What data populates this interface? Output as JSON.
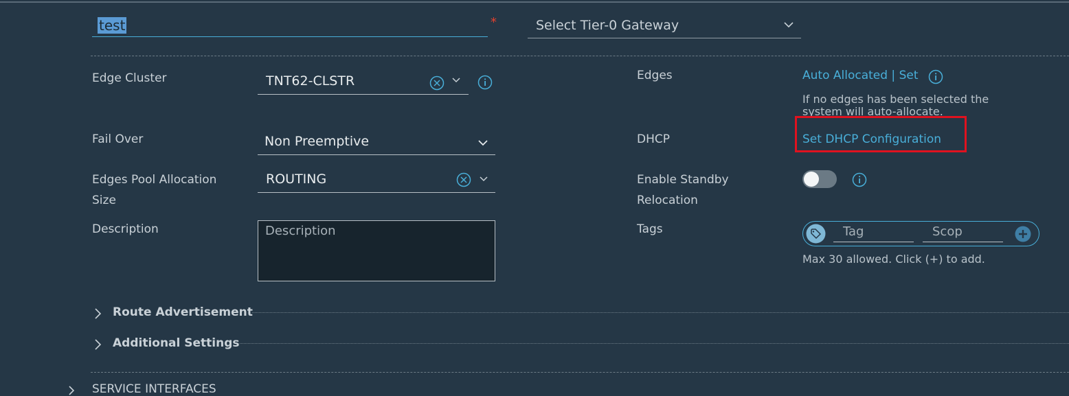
{
  "name_field": {
    "value": "test",
    "required_mark": "*"
  },
  "tier0": {
    "placeholder": "Select Tier-0 Gateway"
  },
  "edge_cluster": {
    "label": "Edge Cluster",
    "value": "TNT62-CLSTR"
  },
  "edges": {
    "label": "Edges",
    "link": "Auto Allocated | Set",
    "help_line1": "If no edges has been selected the",
    "help_line2": "system will auto-allocate."
  },
  "fail_over": {
    "label": "Fail Over",
    "value": "Non Preemptive"
  },
  "dhcp": {
    "label": "DHCP",
    "link": "Set DHCP Configuration"
  },
  "pool_alloc": {
    "label_line1": "Edges Pool Allocation",
    "label_line2": "Size",
    "value": "ROUTING"
  },
  "standby": {
    "label_line1": "Enable Standby",
    "label_line2": "Relocation",
    "enabled": false
  },
  "description": {
    "label": "Description",
    "placeholder": "Description"
  },
  "tags": {
    "label": "Tags",
    "tag_placeholder": "Tag",
    "scope_placeholder": "Scop",
    "help": "Max 30 allowed. Click (+) to add."
  },
  "sections": {
    "route_adv": "Route Advertisement",
    "additional": "Additional Settings",
    "service_interfaces": "SERVICE INTERFACES"
  },
  "colors": {
    "background": "#253746",
    "link": "#49afd9",
    "highlight": "#e0121f",
    "required": "#e5412e"
  }
}
